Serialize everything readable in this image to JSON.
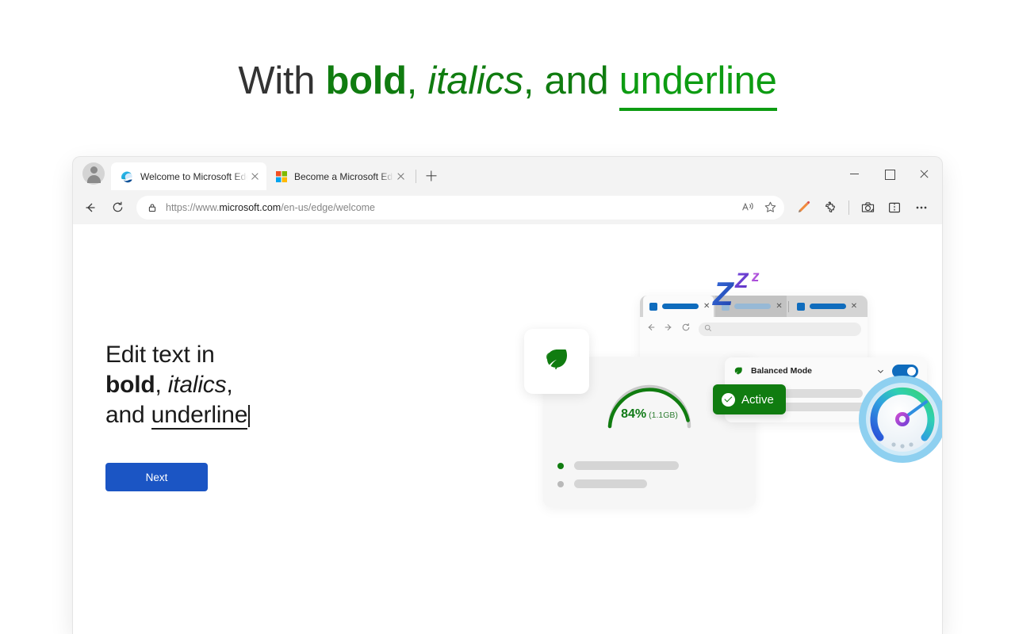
{
  "caption": {
    "with": "With",
    "bold": "bold",
    "comma1": ",",
    "italics": "italics",
    "comma2": ",",
    "and": "and",
    "underline": "underline",
    "color_plain": "#333333",
    "color_green": "#107c10",
    "color_underline": "#0d9c12"
  },
  "browser": {
    "tabs": [
      {
        "title": "Welcome to Microsoft Edge",
        "favicon": "edge-logo-icon",
        "active": true
      },
      {
        "title": "Become a Microsoft Edge Insider",
        "favicon": "microsoft-logo-icon",
        "active": false
      }
    ],
    "new_tab_label": "+",
    "window_controls": {
      "minimize": "minimize-icon",
      "maximize": "maximize-icon",
      "close": "close-icon"
    },
    "toolbar": {
      "back": "back-arrow-icon",
      "refresh": "refresh-icon",
      "lock": "lock-icon",
      "url_scheme": "https://www.",
      "url_domain": "microsoft.com",
      "url_path": "/en-us/edge/welcome",
      "url_full": "https://www.microsoft.com/en-us/edge/welcome",
      "read_aloud": "read-aloud-icon",
      "favorite": "star-icon",
      "pencil": "pencil-icon",
      "extensions": "extensions-puzzle-icon",
      "copilot": "copilot-icon",
      "split_screen": "split-screen-icon",
      "settings_more": "ellipsis-icon"
    }
  },
  "page": {
    "heading_line1": "Edit text in",
    "heading_bold": "bold",
    "heading_comma1": ",",
    "heading_italics": "italics",
    "heading_comma2": ",",
    "heading_and": "and",
    "heading_underline": "underline",
    "next_label": "Next",
    "next_color": "#1b55c4"
  },
  "illustration": {
    "zzz_text": "Zzz",
    "leaf": "leaf-icon",
    "gauge": {
      "percent_label": "84%",
      "size_label": "(1.1GB)",
      "value": 84,
      "arc_color": "#107c10",
      "track_color": "#c9c9c9"
    },
    "balanced_mode": {
      "label": "Balanced Mode",
      "icon": "efficiency-leaf-icon",
      "chevron": "chevron-down-icon",
      "toggle_on": true,
      "toggle_color": "#0f6cbd"
    },
    "active_badge": {
      "label": "Active",
      "icon": "check-circle-icon",
      "color": "#107c10"
    },
    "speedometer": "speedometer-gauge-icon",
    "mock_window": {
      "tabs": [
        {
          "state": "normal"
        },
        {
          "state": "sleeping"
        },
        {
          "state": "normal"
        },
        {
          "state": "normal"
        }
      ],
      "back": "back-arrow-icon",
      "forward": "forward-arrow-icon",
      "refresh": "refresh-icon",
      "search": "search-icon"
    }
  }
}
